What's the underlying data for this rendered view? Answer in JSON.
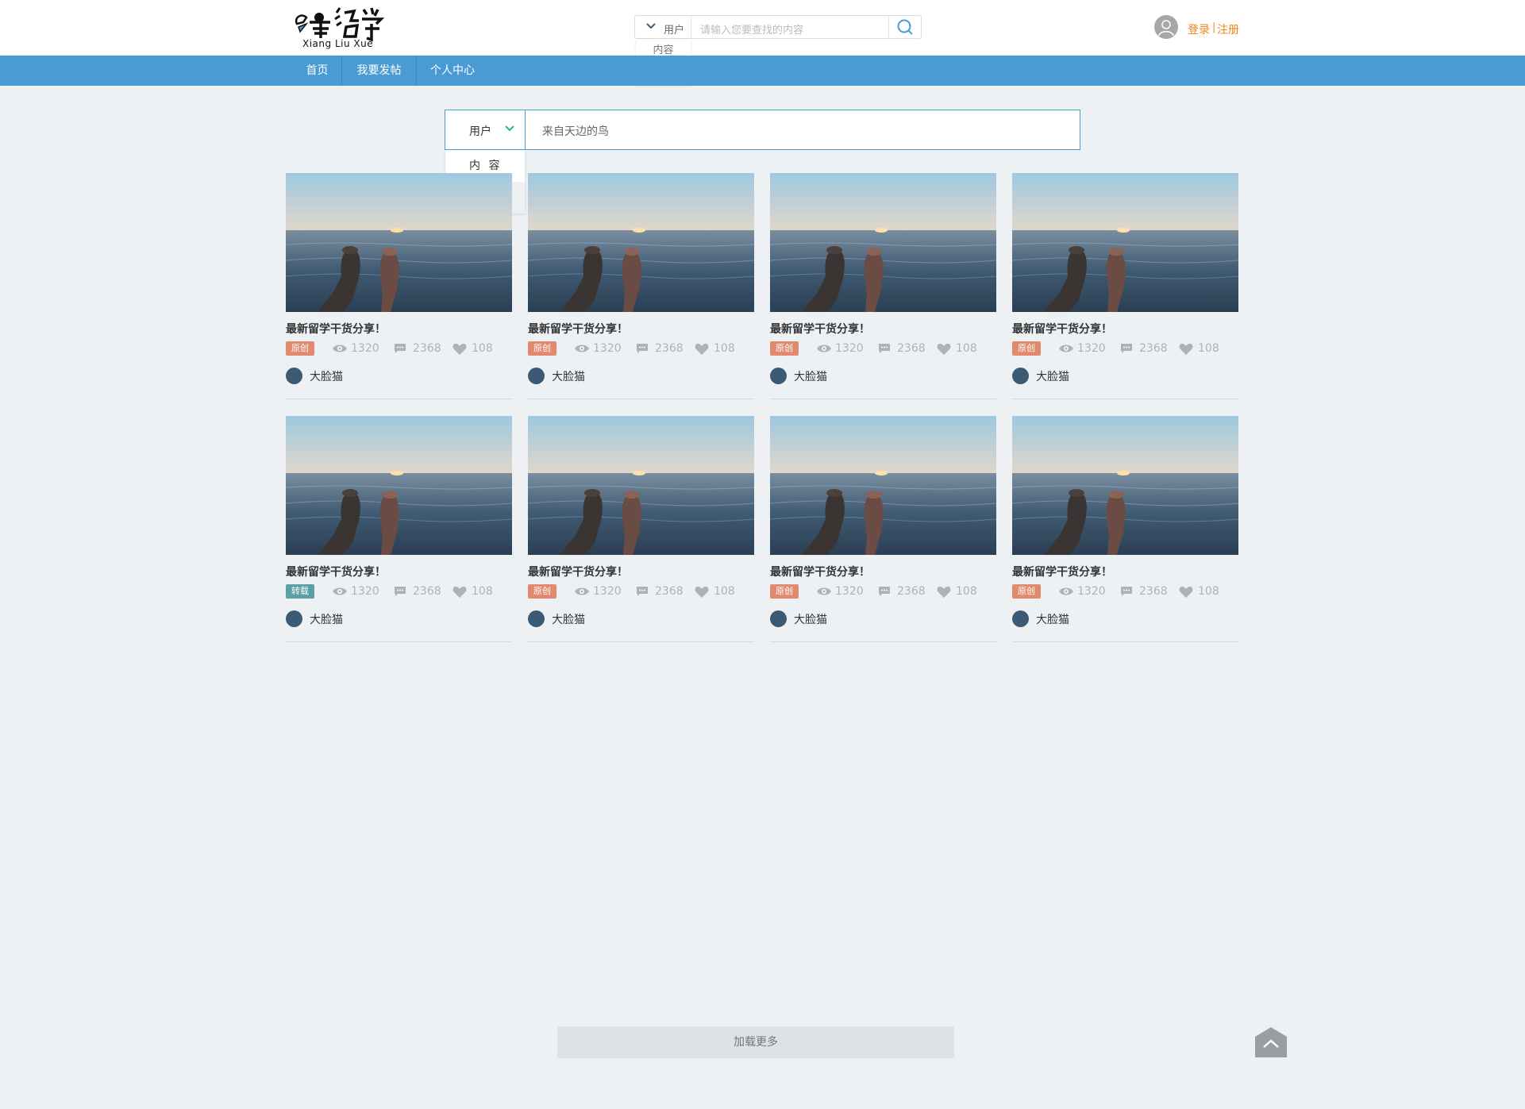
{
  "header": {
    "logo_text": "享留学",
    "logo_subtitle": "Xiang Liu Xue",
    "search": {
      "selected": "用户",
      "placeholder": "请输入您要查找的内容",
      "options": [
        "内容",
        "用户"
      ]
    },
    "login_label": "登录",
    "separator": "|",
    "register_label": "注册"
  },
  "nav": {
    "items": [
      "首页",
      "我要发帖",
      "个人中心"
    ]
  },
  "main_search": {
    "selected": "用户",
    "value": "来自天边的鸟",
    "options": [
      "内 容",
      "用 户"
    ]
  },
  "cards": [
    {
      "title": "最新留学干货分享！",
      "badge": "原创",
      "views": "1320",
      "comments": "2368",
      "likes": "108",
      "author": "大脸猫"
    },
    {
      "title": "最新留学干货分享！",
      "badge": "原创",
      "views": "1320",
      "comments": "2368",
      "likes": "108",
      "author": "大脸猫"
    },
    {
      "title": "最新留学干货分享！",
      "badge": "原创",
      "views": "1320",
      "comments": "2368",
      "likes": "108",
      "author": "大脸猫"
    },
    {
      "title": "最新留学干货分享！",
      "badge": "原创",
      "views": "1320",
      "comments": "2368",
      "likes": "108",
      "author": "大脸猫"
    },
    {
      "title": "最新留学干货分享！",
      "badge": "转载",
      "views": "1320",
      "comments": "2368",
      "likes": "108",
      "author": "大脸猫"
    },
    {
      "title": "最新留学干货分享！",
      "badge": "原创",
      "views": "1320",
      "comments": "2368",
      "likes": "108",
      "author": "大脸猫"
    },
    {
      "title": "最新留学干货分享！",
      "badge": "原创",
      "views": "1320",
      "comments": "2368",
      "likes": "108",
      "author": "大脸猫"
    },
    {
      "title": "最新留学干货分享！",
      "badge": "原创",
      "views": "1320",
      "comments": "2368",
      "likes": "108",
      "author": "大脸猫"
    }
  ],
  "load_more_label": "加载更多",
  "icons": {
    "views": "eye-icon",
    "comments": "comment-icon",
    "likes": "heart-icon",
    "back_to_top": "chevron-up-icon",
    "search": "search-icon"
  },
  "colors": {
    "nav": "#4a9bd3",
    "accent_orange": "#f08519",
    "badge_original": "#e28a6f",
    "badge_repost": "#5c9fa6",
    "background": "#eef1f4"
  }
}
